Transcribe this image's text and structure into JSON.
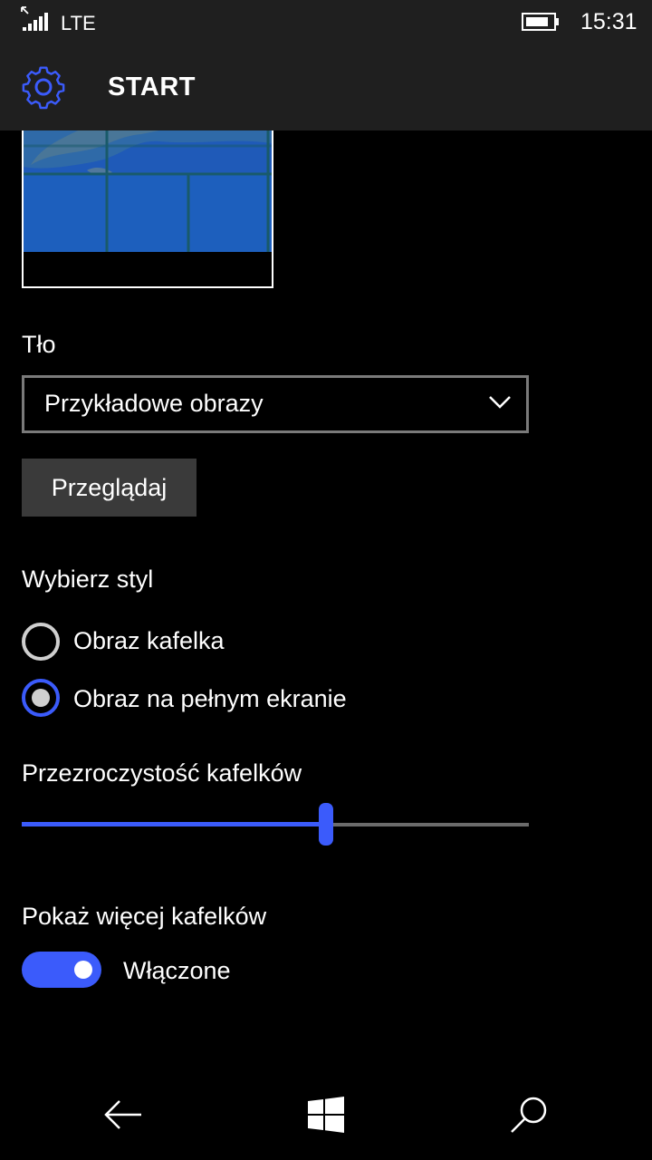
{
  "status_bar": {
    "network": "LTE",
    "time": "15:31",
    "icons": [
      "roaming-arrow-icon",
      "signal-icon",
      "battery-icon"
    ]
  },
  "header": {
    "title": "START",
    "icon": "gear-icon"
  },
  "background": {
    "label": "Tło",
    "dropdown_value": "Przykładowe obrazy",
    "browse_label": "Przeglądaj"
  },
  "style": {
    "label": "Wybierz styl",
    "options": [
      {
        "label": "Obraz kafelka",
        "selected": false
      },
      {
        "label": "Obraz na pełnym ekranie",
        "selected": true
      }
    ]
  },
  "transparency": {
    "label": "Przezroczystość kafelków",
    "value": 0.6
  },
  "more_tiles": {
    "label": "Pokaż więcej kafelków",
    "toggle_label": "Włączone",
    "on": true
  },
  "nav": {
    "icons": [
      "back-arrow-icon",
      "windows-icon",
      "search-icon"
    ]
  },
  "colors": {
    "accent": "#3b5bfb",
    "chrome": "#1f1f1f",
    "background": "#000000"
  }
}
